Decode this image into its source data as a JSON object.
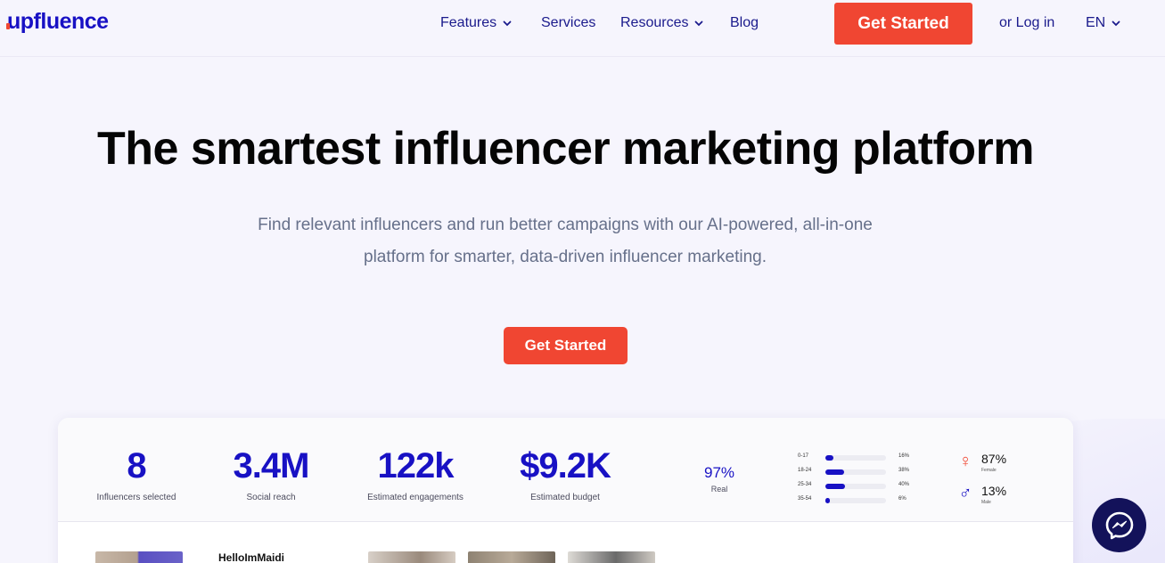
{
  "brand": {
    "logo_text": "upfluence",
    "accent": "#f04632",
    "primary": "#1811c4"
  },
  "nav": {
    "items": [
      {
        "label": "Features",
        "has_dropdown": true
      },
      {
        "label": "Services",
        "has_dropdown": false
      },
      {
        "label": "Resources",
        "has_dropdown": true
      },
      {
        "label": "Blog",
        "has_dropdown": false
      }
    ],
    "cta_label": "Get Started",
    "login_label": "or Log in",
    "language": "EN"
  },
  "hero": {
    "title": "The smartest influencer marketing platform",
    "subtitle": "Find relevant influencers and run better campaigns with our AI-powered, all-in-one platform for smarter, data-driven influencer marketing.",
    "cta_label": "Get Started"
  },
  "dashboard": {
    "stats": [
      {
        "value": "8",
        "label": "Influencers selected"
      },
      {
        "value": "3.4M",
        "label": "Social reach"
      },
      {
        "value": "122k",
        "label": "Estimated engagements"
      },
      {
        "value": "$9.2K",
        "label": "Estimated budget"
      }
    ],
    "real": {
      "value": "97%",
      "label": "Real"
    },
    "age_groups": [
      {
        "range": "0-17",
        "percent": "16%",
        "share": 0.16
      },
      {
        "range": "18-24",
        "percent": "38%",
        "share": 0.38
      },
      {
        "range": "25-34",
        "percent": "40%",
        "share": 0.4
      },
      {
        "range": "35-54",
        "percent": "6%",
        "share": 0.06
      }
    ],
    "gender": {
      "female": {
        "symbol": "♀",
        "value": "87%",
        "label": "Female",
        "color": "#f04632"
      },
      "male": {
        "symbol": "♂",
        "value": "13%",
        "label": "Male",
        "color": "#1811c4"
      }
    },
    "influencer_name": "HelloImMaidi"
  },
  "messenger": {
    "icon": "messenger-icon"
  }
}
